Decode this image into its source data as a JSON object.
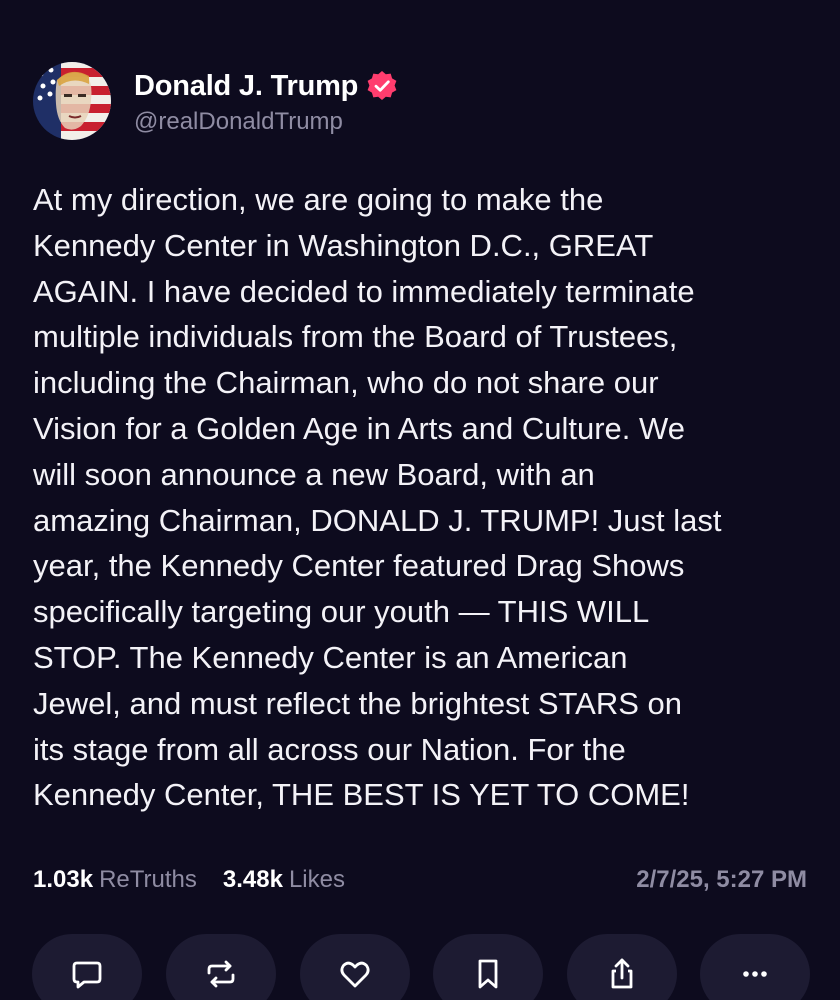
{
  "author": {
    "display_name": "Donald J. Trump",
    "handle": "@realDonaldTrump",
    "verified": true,
    "verified_color": "#ff3d6e"
  },
  "post": {
    "text": "At my direction, we are going to make the\nKennedy Center in Washington D.C., GREAT\nAGAIN. I have decided to immediately terminate\nmultiple individuals from the Board of Trustees,\nincluding the Chairman, who do not share our\nVision for a Golden Age in Arts and Culture. We\nwill soon announce a new Board, with an\namazing Chairman, DONALD J. TRUMP! Just last\nyear, the Kennedy Center featured Drag Shows\nspecifically targeting our youth — THIS WILL\nSTOP. The Kennedy Center is an American\nJewel, and must reflect the brightest STARS on\nits stage from all across our Nation. For the\nKennedy Center, THE BEST IS YET TO COME!"
  },
  "stats": {
    "retruths_count": "1.03k",
    "retruths_label": "ReTruths",
    "likes_count": "3.48k",
    "likes_label": "Likes",
    "timestamp": "2/7/25, 5:27 PM"
  },
  "actions": [
    {
      "name": "reply",
      "icon": "comment-icon"
    },
    {
      "name": "retruth",
      "icon": "repost-icon"
    },
    {
      "name": "like",
      "icon": "heart-icon"
    },
    {
      "name": "bookmark",
      "icon": "bookmark-icon"
    },
    {
      "name": "share",
      "icon": "share-icon"
    },
    {
      "name": "more",
      "icon": "more-icon"
    }
  ],
  "colors": {
    "background": "#0d0b1e",
    "button_background": "#1d1b32",
    "muted_text": "#8f8ca3"
  }
}
